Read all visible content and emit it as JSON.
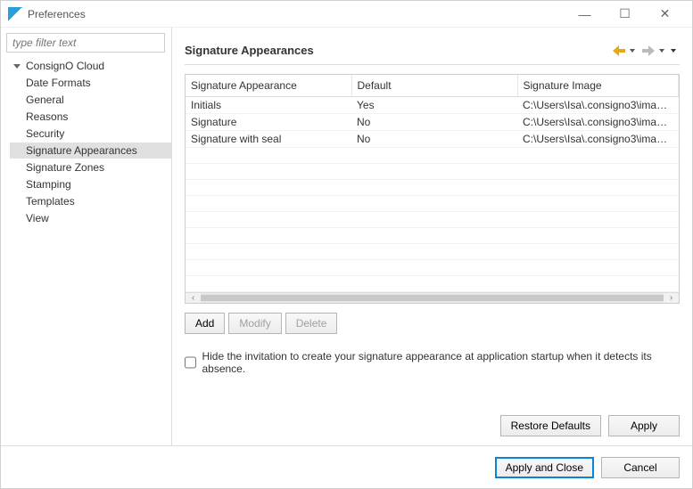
{
  "window": {
    "title": "Preferences"
  },
  "sidebar": {
    "filter_placeholder": "type filter text",
    "items": [
      {
        "label": "ConsignO Cloud",
        "selected": false
      },
      {
        "label": "Date Formats",
        "selected": false
      },
      {
        "label": "General",
        "selected": false
      },
      {
        "label": "Reasons",
        "selected": false
      },
      {
        "label": "Security",
        "selected": false
      },
      {
        "label": "Signature Appearances",
        "selected": true
      },
      {
        "label": "Signature Zones",
        "selected": false
      },
      {
        "label": "Stamping",
        "selected": false
      },
      {
        "label": "Templates",
        "selected": false
      },
      {
        "label": "View",
        "selected": false
      }
    ]
  },
  "panel": {
    "title": "Signature Appearances",
    "table": {
      "headers": {
        "col1": "Signature Appearance",
        "col2": "Default",
        "col3": "Signature Image"
      },
      "rows": [
        {
          "name": "Initials",
          "def": "Yes",
          "img": "C:\\Users\\Isa\\.consigno3\\image..."
        },
        {
          "name": "Signature",
          "def": "No",
          "img": "C:\\Users\\Isa\\.consigno3\\image..."
        },
        {
          "name": "Signature with seal",
          "def": "No",
          "img": "C:\\Users\\Isa\\.consigno3\\image..."
        }
      ]
    },
    "buttons": {
      "add": "Add",
      "modify": "Modify",
      "delete": "Delete"
    },
    "checkbox_label": "Hide the invitation to create your signature appearance at application startup when it detects its absence.",
    "restore": "Restore Defaults",
    "apply": "Apply"
  },
  "footer": {
    "apply_close": "Apply and Close",
    "cancel": "Cancel"
  }
}
